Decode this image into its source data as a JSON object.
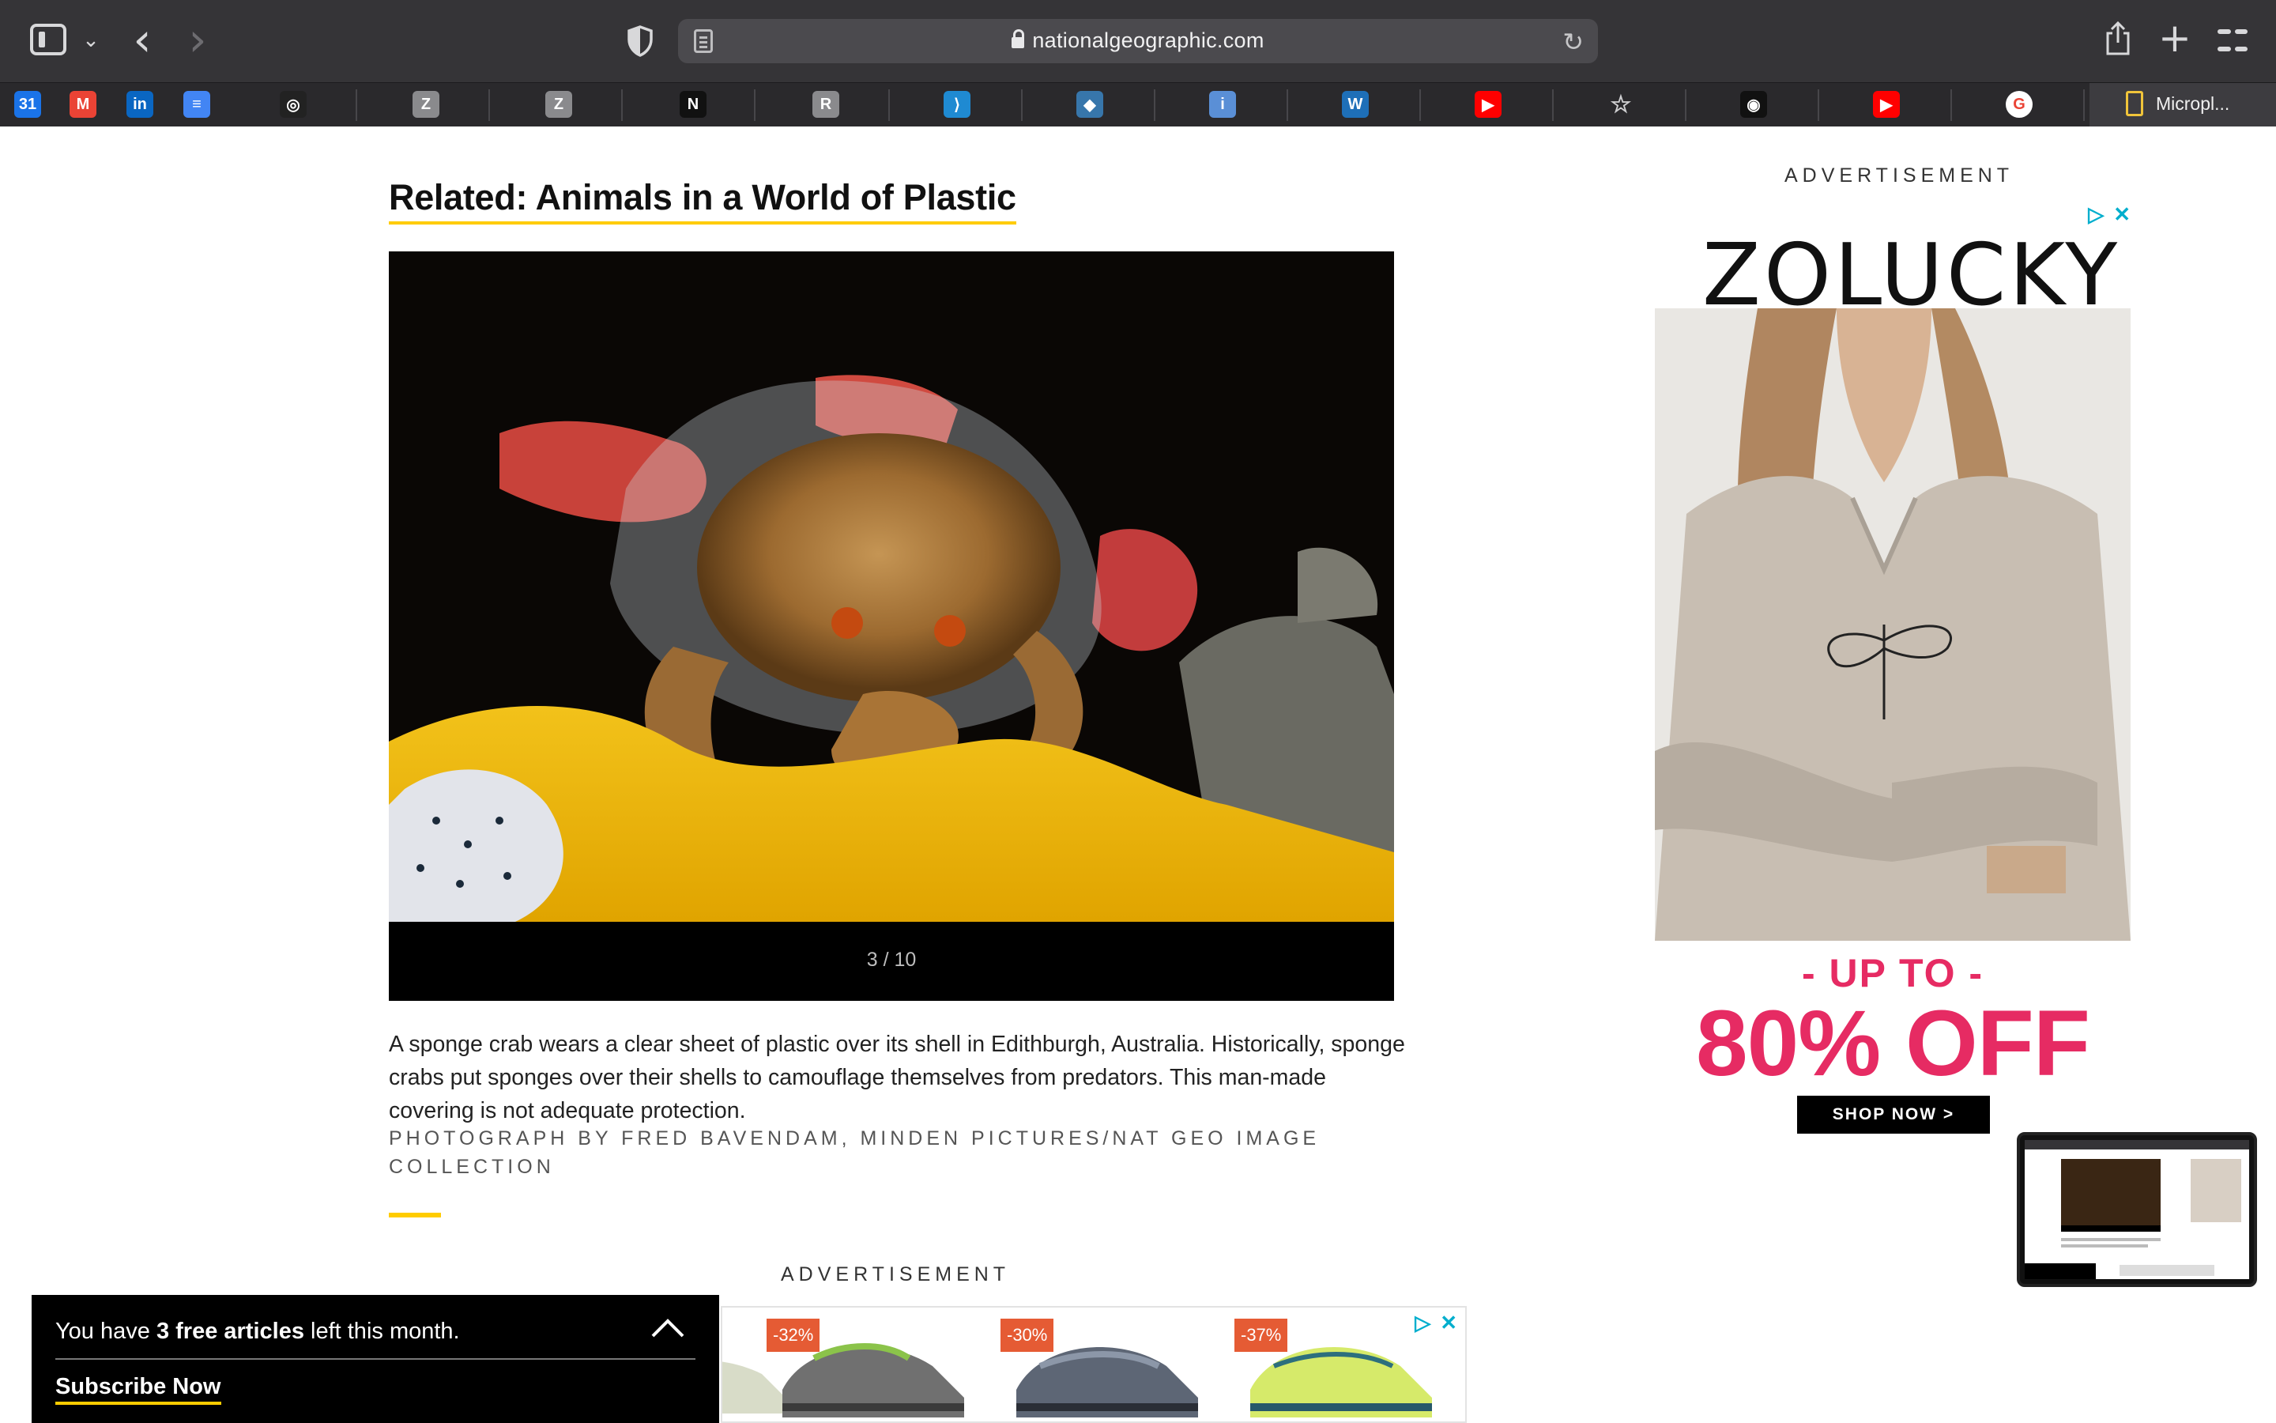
{
  "browser": {
    "url": "nationalgeographic.com",
    "bookmarks": [
      {
        "icon": "google-calendar-icon",
        "label": "31",
        "color": "#1a73e8"
      },
      {
        "icon": "gmail-icon",
        "label": "M",
        "color": "#ea4335"
      },
      {
        "icon": "linkedin-icon",
        "label": "in",
        "color": "#0a66c2"
      },
      {
        "icon": "google-docs-icon",
        "label": "≡",
        "color": "#4285f4"
      },
      {
        "icon": "target-icon",
        "label": "◎",
        "color": "#222222"
      },
      {
        "icon": "zotero-icon",
        "label": "Z",
        "color": "#8a8a8d"
      },
      {
        "icon": "zotero-icon",
        "label": "Z",
        "color": "#8a8a8d"
      },
      {
        "icon": "notion-icon",
        "label": "N",
        "color": "#111111"
      },
      {
        "icon": "r-icon",
        "label": "R",
        "color": "#8a8a8d"
      },
      {
        "icon": "vscode-icon",
        "label": "⟩",
        "color": "#1f8ad2"
      },
      {
        "icon": "python-icon",
        "label": "◆",
        "color": "#3776ab"
      },
      {
        "icon": "info-icon",
        "label": "i",
        "color": "#5a8fd6"
      },
      {
        "icon": "w-icon",
        "label": "W",
        "color": "#1e6fb8"
      },
      {
        "icon": "youtube-icon",
        "label": "▶",
        "color": "#ff0000"
      },
      {
        "icon": "star-icon",
        "label": "☆",
        "color": "transparent"
      },
      {
        "icon": "github-icon",
        "label": "◉",
        "color": "#111111"
      },
      {
        "icon": "youtube-icon",
        "label": "▶",
        "color": "#ff0000"
      },
      {
        "icon": "google-icon",
        "label": "G",
        "color": "#ffffff"
      }
    ],
    "last_bookmark": "Micropl..."
  },
  "article": {
    "related_title": "Related: Animals in a World of Plastic",
    "counter": "3 / 10",
    "caption": "A sponge crab wears a clear sheet of plastic over its shell in Edithburgh, Australia. Historically, sponge crabs put sponges over their shells to camouflage themselves from predators. This man-made covering is not adequate protection.",
    "credit": "PHOTOGRAPH BY FRED BAVENDAM, MINDEN PICTURES/NAT GEO IMAGE COLLECTION",
    "ad_label_bottom": "ADVERTISEMENT"
  },
  "side_ad": {
    "label": "ADVERTISEMENT",
    "brand": "ZOLUCKY",
    "upto": "- UP TO -",
    "discount": "80% OFF",
    "cta": "SHOP NOW >"
  },
  "shoe_ad": {
    "discounts": [
      "-32%",
      "-30%",
      "-37%"
    ]
  },
  "paywall": {
    "prefix": "You have ",
    "count": "3 free articles",
    "suffix": " left this month.",
    "cta": "Subscribe Now"
  },
  "colors": {
    "accent_yellow": "#ffcc00",
    "sale_pink": "#e62b63",
    "adchoices_cyan": "#00aecd"
  }
}
